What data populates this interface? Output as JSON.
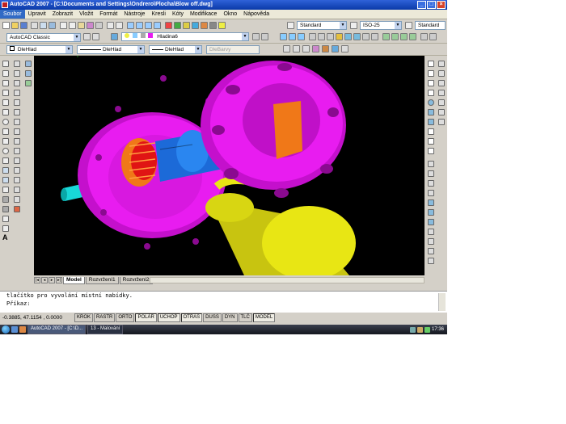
{
  "window": {
    "title": "AutoCAD 2007 - [C:\\Documents and Settings\\Ondrero\\Plocha\\Blow off.dwg]",
    "controls": [
      "_",
      "□",
      "×"
    ]
  },
  "menu": [
    "Soubor",
    "Upravit",
    "Zobrazit",
    "Vložit",
    "Formát",
    "Nástroje",
    "Kresli",
    "Kóty",
    "Modifikace",
    "Okno",
    "Nápověda"
  ],
  "toolbar": {
    "text_style": "Standard",
    "dim_style": "ISO-25",
    "table_style": "Standard",
    "workspace": "AutoCAD Classic",
    "layer": "Hladina6",
    "color": "DleHlad",
    "linetype": "DleHlad",
    "lineweight": "DleHlad",
    "plotstyle": "DleBarvy"
  },
  "tabs": [
    "Model",
    "Rozvržení1",
    "Rozvržení2"
  ],
  "active_tab": "Model",
  "command": {
    "history": "tlačítko pro vyvolání místní nabídky.",
    "prompt": "Příkaz:"
  },
  "status": {
    "coords": "-0.3885, 47.1154 , 0.0000",
    "buttons": [
      "KROK",
      "RASTR",
      "ORTO",
      "POLÁR",
      "UCHOP",
      "OTRAS",
      "DUSS",
      "DYN",
      "TLČ",
      "MODEL"
    ],
    "active": [
      "POLÁR",
      "UCHOP",
      "OTRAS",
      "MODEL"
    ]
  },
  "taskbar": {
    "tasks": [
      "AutoCAD 2007 - [C:\\D...",
      "13 - Malování"
    ],
    "clock": "17:36"
  },
  "colors": {
    "magenta": "#e81cf0",
    "yellow": "#e8e614",
    "orange": "#f07818",
    "blue": "#1c6ad8",
    "cyan": "#18d8d8",
    "red": "#e01414"
  },
  "ucs_label": "Y"
}
